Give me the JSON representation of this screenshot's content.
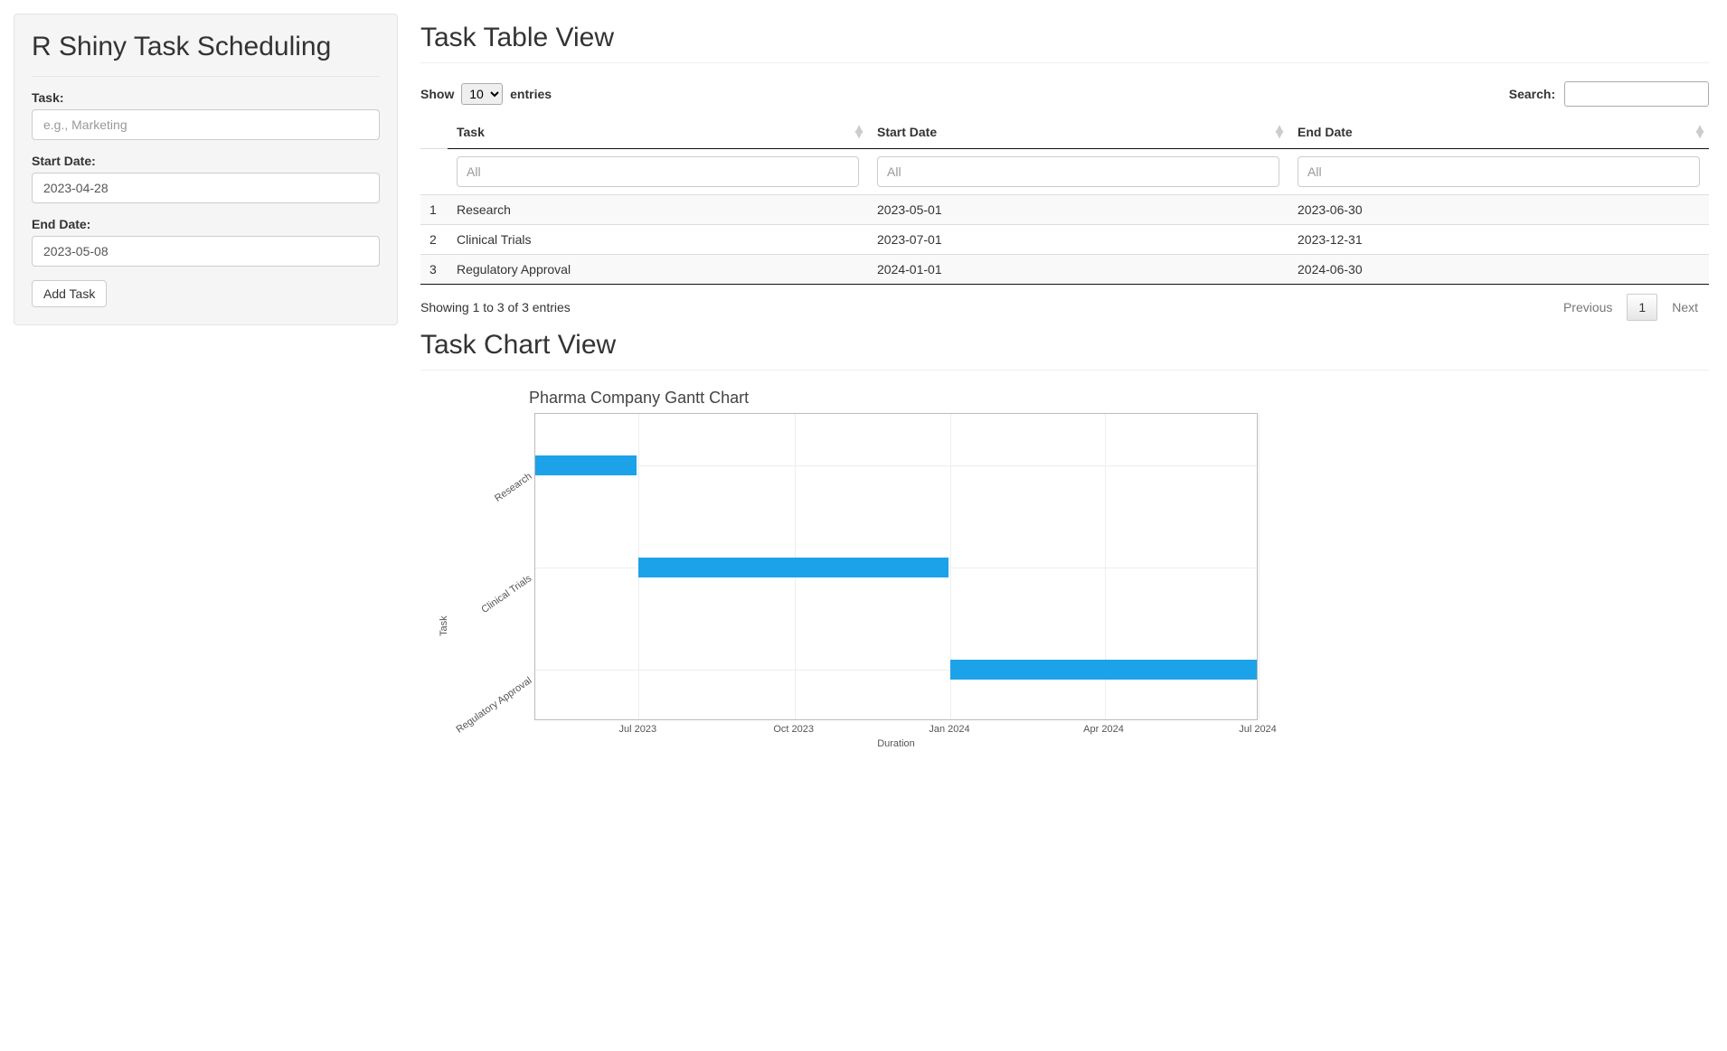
{
  "sidebar": {
    "title": "R Shiny Task Scheduling",
    "task_label": "Task:",
    "task_placeholder": "e.g., Marketing",
    "task_value": "",
    "start_label": "Start Date:",
    "start_value": "2023-04-28",
    "end_label": "End Date:",
    "end_value": "2023-05-08",
    "add_button": "Add Task"
  },
  "table_view": {
    "heading": "Task Table View",
    "show_label_pre": "Show",
    "show_value": "10",
    "show_label_post": "entries",
    "search_label": "Search:",
    "search_value": "",
    "columns": {
      "task": "Task",
      "start": "Start Date",
      "end": "End Date"
    },
    "filter_placeholder": "All",
    "rows": [
      {
        "idx": "1",
        "task": "Research",
        "start": "2023-05-01",
        "end": "2023-06-30"
      },
      {
        "idx": "2",
        "task": "Clinical Trials",
        "start": "2023-07-01",
        "end": "2023-12-31"
      },
      {
        "idx": "3",
        "task": "Regulatory Approval",
        "start": "2024-01-01",
        "end": "2024-06-30"
      }
    ],
    "info": "Showing 1 to 3 of 3 entries",
    "prev": "Previous",
    "page": "1",
    "next": "Next"
  },
  "chart_view": {
    "heading": "Task Chart View"
  },
  "chart_data": {
    "type": "bar",
    "title": "Pharma Company Gantt Chart",
    "xlabel": "Duration",
    "ylabel": "Task",
    "x_ticks": [
      "Jul 2023",
      "Oct 2023",
      "Jan 2024",
      "Apr 2024",
      "Jul 2024"
    ],
    "x_range": [
      "2023-05-01",
      "2024-07-01"
    ],
    "categories": [
      "Research",
      "Clinical Trials",
      "Regulatory Approval"
    ],
    "series": [
      {
        "name": "Research",
        "start": "2023-05-01",
        "end": "2023-06-30"
      },
      {
        "name": "Clinical Trials",
        "start": "2023-07-01",
        "end": "2023-12-31"
      },
      {
        "name": "Regulatory Approval",
        "start": "2024-01-01",
        "end": "2024-06-30"
      }
    ]
  }
}
